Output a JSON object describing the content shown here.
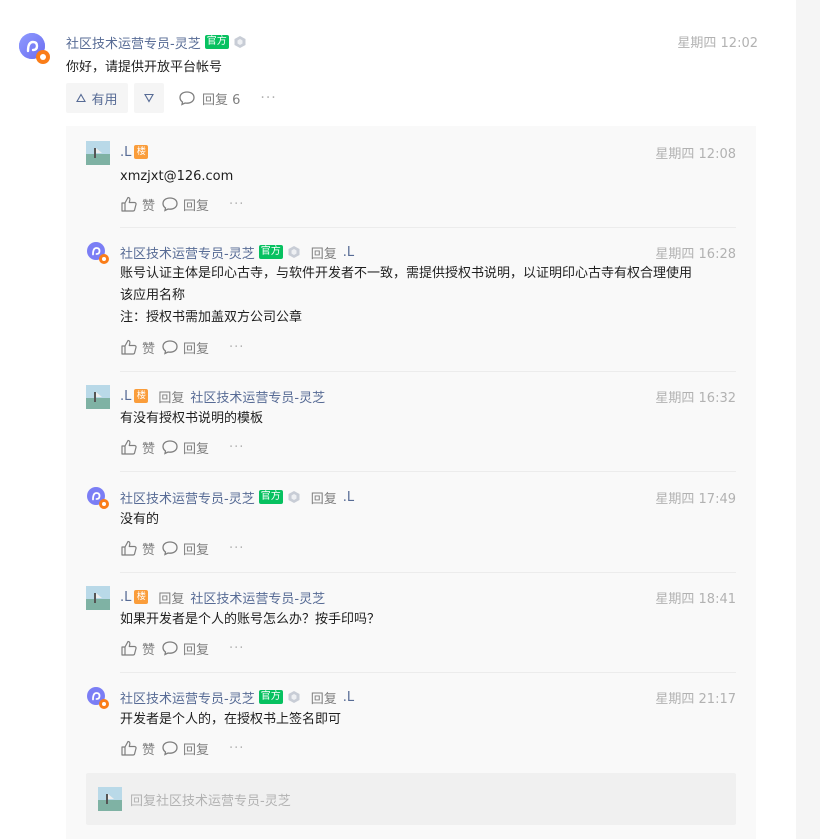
{
  "main": {
    "author": "社区技术运营专员-灵芝",
    "official_tag": "官方",
    "time": "星期四 12:02",
    "text": "你好，请提供开放平台帐号",
    "useful_label": "有用",
    "reply_label": "回复 6"
  },
  "replies": [
    {
      "author": ".L",
      "lou_tag": "楼",
      "time": "星期四 12:08",
      "lines": [
        "xmzjxt@126.com"
      ],
      "like_label": "赞",
      "reply_label": "回复"
    },
    {
      "author": "社区技术运营专员-灵芝",
      "official_tag": "官方",
      "reply_word": "回复",
      "reply_to": ".L",
      "time": "星期四 16:28",
      "lines": [
        "账号认证主体是印心古寺，与软件开发者不一致，需提供授权书说明，以证明印心古寺有权合理使用",
        "该应用名称",
        "注：授权书需加盖双方公司公章"
      ],
      "like_label": "赞",
      "reply_label": "回复"
    },
    {
      "author": ".L",
      "lou_tag": "楼",
      "reply_word": "回复",
      "reply_to": "社区技术运营专员-灵芝",
      "time": "星期四 16:32",
      "lines": [
        "有没有授权书说明的模板"
      ],
      "like_label": "赞",
      "reply_label": "回复"
    },
    {
      "author": "社区技术运营专员-灵芝",
      "official_tag": "官方",
      "reply_word": "回复",
      "reply_to": ".L",
      "time": "星期四 17:49",
      "lines": [
        "没有的"
      ],
      "like_label": "赞",
      "reply_label": "回复"
    },
    {
      "author": ".L",
      "lou_tag": "楼",
      "reply_word": "回复",
      "reply_to": "社区技术运营专员-灵芝",
      "time": "星期四 18:41",
      "lines": [
        "如果开发者是个人的账号怎么办？按手印吗？"
      ],
      "like_label": "赞",
      "reply_label": "回复"
    },
    {
      "author": "社区技术运营专员-灵芝",
      "official_tag": "官方",
      "reply_word": "回复",
      "reply_to": ".L",
      "time": "星期四 21:17",
      "lines": [
        "开发者是个人的，在授权书上签名即可"
      ],
      "like_label": "赞",
      "reply_label": "回复"
    }
  ],
  "reply_box": {
    "placeholder": "回复社区技术运营专员-灵芝"
  },
  "colors": {
    "link": "#576b95",
    "official_green": "#07c160",
    "lou_orange": "#fa9d3b",
    "muted": "#b2b2b2"
  }
}
